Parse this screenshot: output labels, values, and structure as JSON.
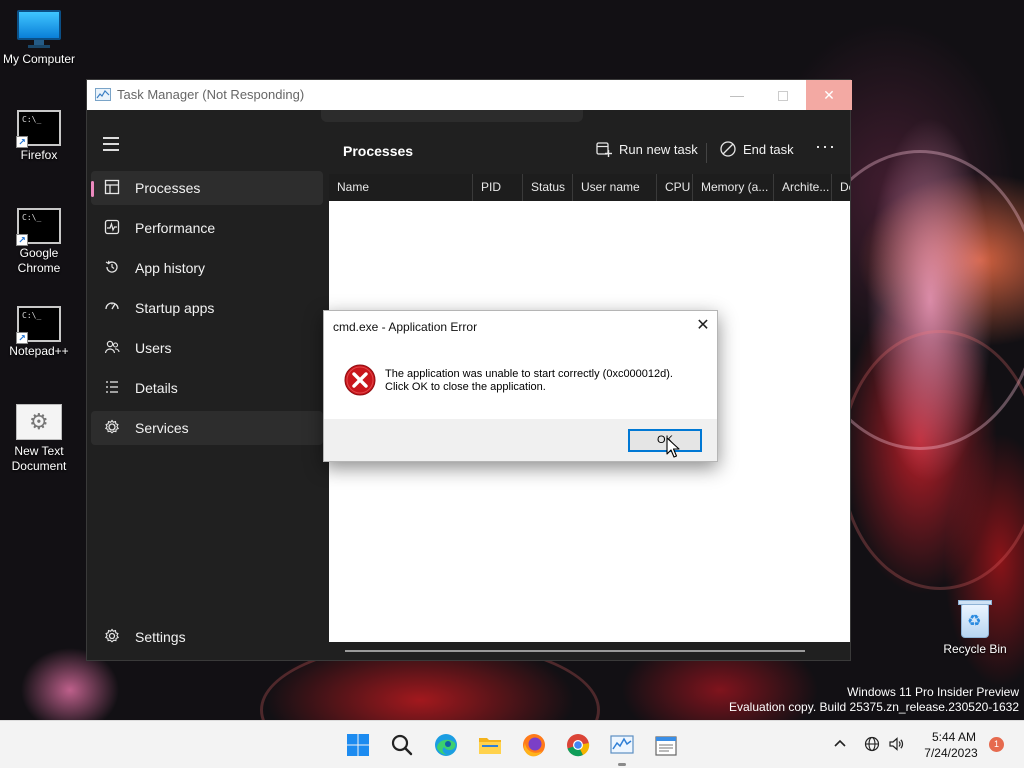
{
  "desktop": {
    "icons": [
      {
        "label": "My Computer"
      },
      {
        "label": "Firefox"
      },
      {
        "label": "Google Chrome"
      },
      {
        "label": "Notepad++"
      },
      {
        "label": "New Text Document"
      },
      {
        "label": "Recycle Bin"
      }
    ]
  },
  "task_manager": {
    "title": "Task Manager (Not Responding)",
    "nav": [
      {
        "label": "Processes",
        "icon": "processes-icon"
      },
      {
        "label": "Performance",
        "icon": "performance-icon"
      },
      {
        "label": "App history",
        "icon": "app-history-icon"
      },
      {
        "label": "Startup apps",
        "icon": "startup-apps-icon"
      },
      {
        "label": "Users",
        "icon": "users-icon"
      },
      {
        "label": "Details",
        "icon": "details-icon"
      },
      {
        "label": "Services",
        "icon": "services-icon"
      }
    ],
    "settings_label": "Settings",
    "page_title": "Processes",
    "toolbar": {
      "run_new_task": "Run new task",
      "end_task": "End task",
      "more": "···"
    },
    "columns": [
      "Name",
      "PID",
      "Status",
      "User name",
      "CPU",
      "Memory (a...",
      "Archite...",
      "De"
    ],
    "accent": "#ec8abf"
  },
  "error_dialog": {
    "title": "cmd.exe - Application Error",
    "message_line1": "The application was unable to start correctly (0xc000012d).",
    "message_line2": "Click OK to close the application.",
    "ok_label": "OK"
  },
  "watermark": {
    "line1": "Windows 11 Pro Insider Preview",
    "line2": "Evaluation copy. Build 25375.zn_release.230520-1632"
  },
  "taskbar": {
    "apps": [
      "start-icon",
      "search-icon",
      "edge-icon",
      "file-explorer-icon",
      "firefox-icon",
      "chrome-icon",
      "task-manager-icon",
      "notepad-icon"
    ],
    "time": "5:44 AM",
    "date": "7/24/2023",
    "notification_count": "1"
  }
}
